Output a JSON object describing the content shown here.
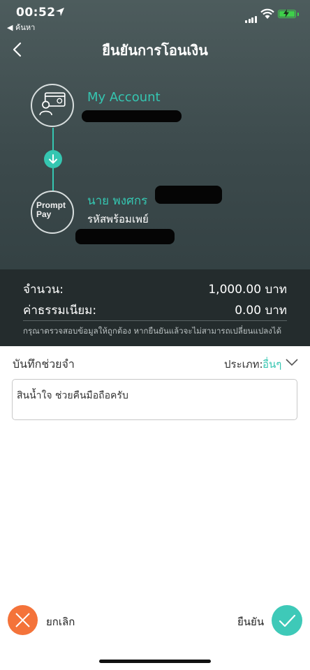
{
  "status_bar": {
    "time": "00:52",
    "back_app": "◀ ค้นหา"
  },
  "header": {
    "title": "ยืนยันการโอนเงิน"
  },
  "from_account": {
    "name": "My Account",
    "icon": "account-card-icon"
  },
  "to_account": {
    "name": "นาย พงศกร",
    "id_label": "รหัสพร้อมเพย์",
    "logo_text_line1": "Prompt",
    "logo_text_line2": "Pay"
  },
  "summary": {
    "amount_label": "จำนวน:",
    "amount_value": "1,000.00 บาท",
    "fee_label": "ค่าธรรมเนียม:",
    "fee_value": "0.00 บาท",
    "warning": "กรุณาตรวจสอบข้อมูลให้ถูกต้อง หากยืนยันแล้วจะไม่สามารถเปลี่ยนแปลงได้"
  },
  "memo": {
    "title": "บันทึกช่วยจำ",
    "category_label": "ประเภท:",
    "category_value": "อื่นๆ",
    "text": "สินน้ำใจ ช่วยคืนมือถือครับ"
  },
  "actions": {
    "cancel_label": "ยกเลิก",
    "confirm_label": "ยืนยัน"
  },
  "colors": {
    "accent": "#35c6b1",
    "cancel": "#f4733a",
    "confirm": "#3ec9b8",
    "header_bg": "#3c4a4c",
    "summary_bg": "#242c2d"
  }
}
